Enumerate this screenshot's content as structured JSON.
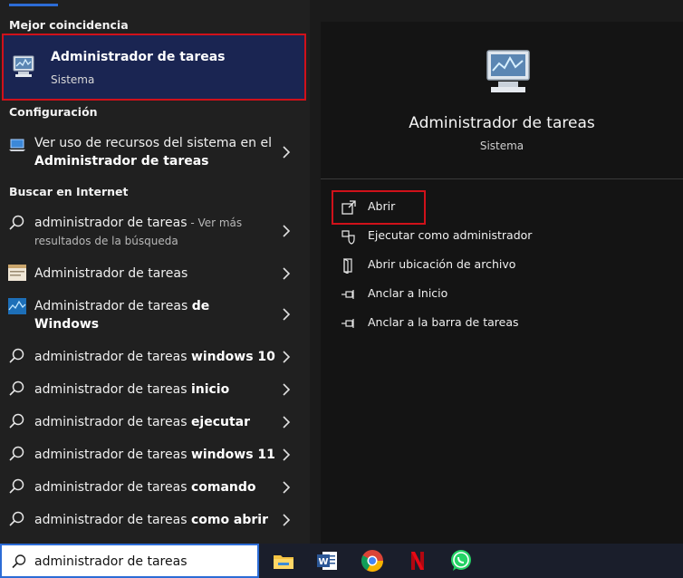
{
  "left_pane": {
    "best_match_header": "Mejor coincidencia",
    "best_match": {
      "title": "Administrador de tareas",
      "subtitle": "Sistema"
    },
    "config_header": "Configuración",
    "config_item": {
      "line1": "Ver uso de recursos del sistema en el",
      "line2": "Administrador de tareas"
    },
    "web_header": "Buscar en Internet",
    "web_items": [
      {
        "prefix": "administrador de tareas",
        "suffix": " - Ver más",
        "line2": "resultados de la búsqueda"
      },
      {
        "prefix": "Administrador de tareas",
        "bold": ""
      },
      {
        "prefix": "Administrador de tareas ",
        "bold": "de",
        "line2": "Windows"
      },
      {
        "prefix": "administrador de tareas ",
        "bold": "windows 10"
      },
      {
        "prefix": "administrador de tareas ",
        "bold": "inicio"
      },
      {
        "prefix": "administrador de tareas ",
        "bold": "ejecutar"
      },
      {
        "prefix": "administrador de tareas ",
        "bold": "windows 11"
      },
      {
        "prefix": "administrador de tareas ",
        "bold": "comando"
      },
      {
        "prefix": "administrador de tareas ",
        "bold": "como abrir"
      }
    ]
  },
  "right_pane": {
    "title": "Administrador de tareas",
    "subtitle": "Sistema",
    "actions": [
      {
        "label": "Abrir",
        "icon": "open-icon"
      },
      {
        "label": "Ejecutar como administrador",
        "icon": "shield-icon"
      },
      {
        "label": "Abrir ubicación de archivo",
        "icon": "file-location-icon"
      },
      {
        "label": "Anclar a Inicio",
        "icon": "pin-icon"
      },
      {
        "label": "Anclar a la barra de tareas",
        "icon": "pin-icon"
      }
    ]
  },
  "taskbar": {
    "search_value": "administrador de tareas",
    "apps": [
      "file-explorer-icon",
      "word-icon",
      "chrome-icon",
      "netflix-icon",
      "whatsapp-icon"
    ]
  },
  "colors": {
    "accent": "#2c6cd6",
    "highlight_border": "#d0111a",
    "selected_bg": "#1a2552"
  }
}
